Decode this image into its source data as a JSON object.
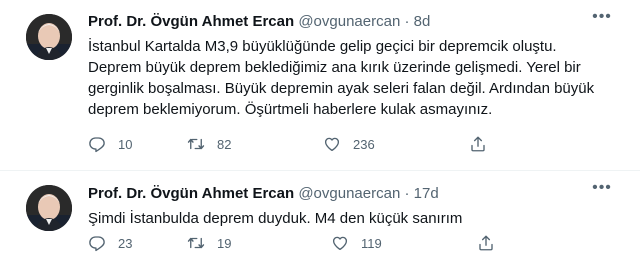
{
  "tweets": [
    {
      "name": "Prof. Dr. Övgün Ahmet Ercan",
      "handle": "@ovgunaercan",
      "dot": "·",
      "time": "8d",
      "more": "•••",
      "text_lines": [
        "İstanbul Kartalda M3,9 büyüklüğünde gelip geçici bir depremcik oluştu.",
        "Deprem büyük deprem beklediğimiz ana kırık üzerinde gelişmedi. Yerel bir",
        "gerginlik boşalması. Büyük depremin ayak seleri falan değil. Ardından büyük",
        "deprem beklemiyorum. Öşürtmeli haberlere kulak asmayınız."
      ],
      "reply_count": "10",
      "retweet_count": "82",
      "like_count": "236"
    },
    {
      "name": "Prof. Dr. Övgün Ahmet Ercan",
      "handle": "@ovgunaercan",
      "dot": "·",
      "time": "17d",
      "more": "•••",
      "text_lines": [
        "Şimdi İstanbulda deprem duyduk. M4 den küçük sanırım"
      ],
      "reply_count": "23",
      "retweet_count": "19",
      "like_count": "119"
    }
  ],
  "icons": {
    "reply": "reply-icon",
    "retweet": "retweet-icon",
    "like": "heart-icon",
    "share": "share-icon",
    "more": "more-icon"
  },
  "colors": {
    "text": "#0f1419",
    "secondary": "#536471",
    "divider": "#eff3f4"
  }
}
